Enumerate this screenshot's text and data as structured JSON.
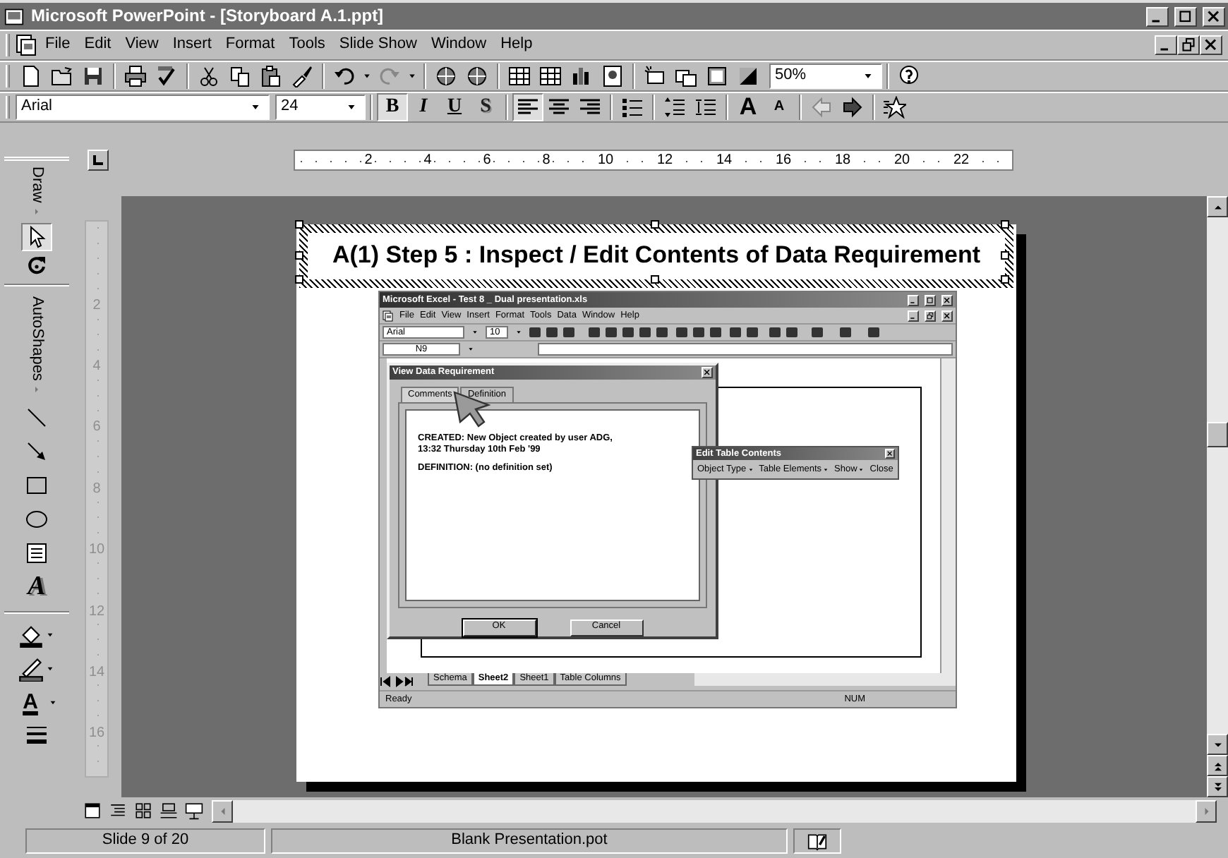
{
  "window": {
    "title": "Microsoft PowerPoint - [Storyboard A.1.ppt]"
  },
  "menu": [
    {
      "label": "File"
    },
    {
      "label": "Edit"
    },
    {
      "label": "View"
    },
    {
      "label": "Insert"
    },
    {
      "label": "Format"
    },
    {
      "label": "Tools"
    },
    {
      "label": "Slide Show"
    },
    {
      "label": "Window"
    },
    {
      "label": "Help"
    }
  ],
  "standard_toolbar": {
    "zoom": "50%"
  },
  "formatting_toolbar": {
    "font": "Arial",
    "size": "24",
    "buttons": [
      {
        "kind": "bold",
        "label": "B",
        "pressed": true
      },
      {
        "kind": "italic",
        "label": "I",
        "pressed": false
      },
      {
        "kind": "underline",
        "label": "U",
        "pressed": false
      },
      {
        "kind": "shadow",
        "label": "S",
        "pressed": false
      },
      {
        "kind": "align-left",
        "pressed": true
      },
      {
        "kind": "align-center",
        "pressed": false
      },
      {
        "kind": "align-right",
        "pressed": false
      },
      {
        "kind": "grow",
        "label": "A",
        "pressed": false
      },
      {
        "kind": "shrink",
        "label": "A",
        "pressed": false
      }
    ]
  },
  "draw_toolbar": {
    "menus": [
      {
        "label": "Draw"
      },
      {
        "label": "AutoShapes"
      }
    ],
    "select_pressed": true,
    "wordart_label": "A",
    "font_color_label": "A"
  },
  "rulers": {
    "horizontal": [
      "2",
      "4",
      "6",
      "8",
      "10",
      "12",
      "14",
      "16",
      "18",
      "20",
      "22"
    ],
    "vertical": [
      "2",
      "4",
      "6",
      "8",
      "10",
      "12",
      "14",
      "16"
    ]
  },
  "slide": {
    "title": "A(1) Step 5 :  Inspect / Edit Contents of Data Requirement",
    "title_selected": true,
    "excel": {
      "title": "Microsoft Excel - Test 8 _ Dual presentation.xls",
      "menu": [
        {
          "label": "File"
        },
        {
          "label": "Edit"
        },
        {
          "label": "View"
        },
        {
          "label": "Insert"
        },
        {
          "label": "Format"
        },
        {
          "label": "Tools"
        },
        {
          "label": "Data"
        },
        {
          "label": "Window"
        },
        {
          "label": "Help"
        }
      ],
      "font": "Arial",
      "size": "10",
      "name_box": "N9",
      "dialog": {
        "title": "View Data Requirement",
        "tabs": [
          {
            "label": "Comments",
            "selected": true
          },
          {
            "label": "Definition",
            "selected": false
          }
        ],
        "lines": [
          "CREATED: New Object created by user ADG, 13:32 Thursday 10th Feb '99",
          "DEFINITION: (no definition set)"
        ],
        "buttons": [
          "OK",
          "Cancel"
        ]
      },
      "floating_toolbar": {
        "title": "Edit Table Contents",
        "items": [
          {
            "label": "Object Type",
            "dropdown": true
          },
          {
            "label": "Table Elements",
            "dropdown": true
          },
          {
            "label": "Show",
            "dropdown": true
          },
          {
            "label": "Close",
            "dropdown": false
          }
        ]
      },
      "sheet_tabs": [
        {
          "label": "Schema",
          "selected": false
        },
        {
          "label": "Sheet2",
          "selected": true
        },
        {
          "label": "Sheet1",
          "selected": false
        },
        {
          "label": "Table Columns",
          "selected": false
        }
      ],
      "status": [
        "Ready",
        "NUM"
      ]
    }
  },
  "status_bar": [
    "Slide 9 of 20",
    "Blank Presentation.pot"
  ]
}
